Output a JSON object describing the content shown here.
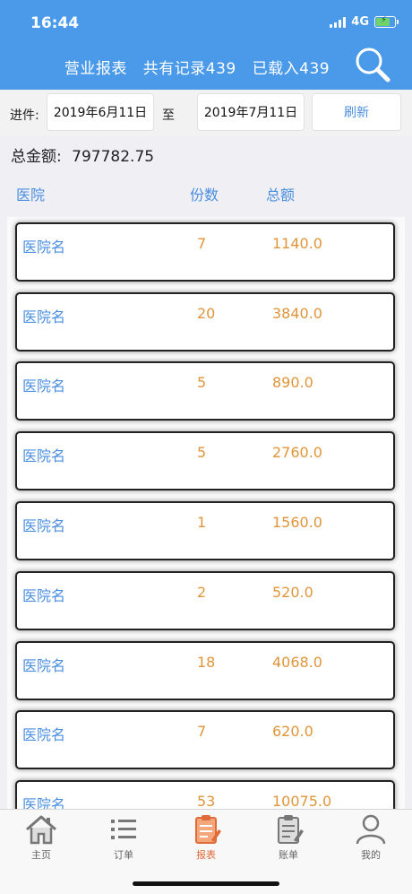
{
  "status": {
    "time": "16:44",
    "network": "4G"
  },
  "nav": {
    "title": "营业报表",
    "total_records": "共有记录439",
    "loaded": "已载入439"
  },
  "filter": {
    "from_label": "进件:",
    "from_date": "2019年6月11日",
    "to_label": "至",
    "to_date": "2019年7月11日",
    "refresh_label": "刷新"
  },
  "summary": {
    "label": "总金额:",
    "value": "797782.75"
  },
  "columns": {
    "hospital": "医院",
    "count": "份数",
    "amount": "总额"
  },
  "rows": [
    {
      "name": "医院名",
      "count": "7",
      "amount": "1140.0"
    },
    {
      "name": "医院名",
      "count": "20",
      "amount": "3840.0"
    },
    {
      "name": "医院名",
      "count": "5",
      "amount": "890.0"
    },
    {
      "name": "医院名",
      "count": "5",
      "amount": "2760.0"
    },
    {
      "name": "医院名",
      "count": "1",
      "amount": "1560.0"
    },
    {
      "name": "医院名",
      "count": "2",
      "amount": "520.0"
    },
    {
      "name": "医院名",
      "count": "18",
      "amount": "4068.0"
    },
    {
      "name": "医院名",
      "count": "7",
      "amount": "620.0"
    },
    {
      "name": "医院名",
      "count": "53",
      "amount": "10075.0"
    }
  ],
  "tabs": [
    {
      "label": "主页",
      "icon": "home-icon"
    },
    {
      "label": "订单",
      "icon": "list-icon"
    },
    {
      "label": "报表",
      "icon": "report-icon",
      "active": true
    },
    {
      "label": "账单",
      "icon": "bill-icon"
    },
    {
      "label": "我的",
      "icon": "profile-icon"
    }
  ],
  "colors": {
    "header": "#4a9ae9",
    "accent_blue": "#4a8ee0",
    "accent_orange": "#e0953a",
    "active_tab": "#e06a3a"
  }
}
